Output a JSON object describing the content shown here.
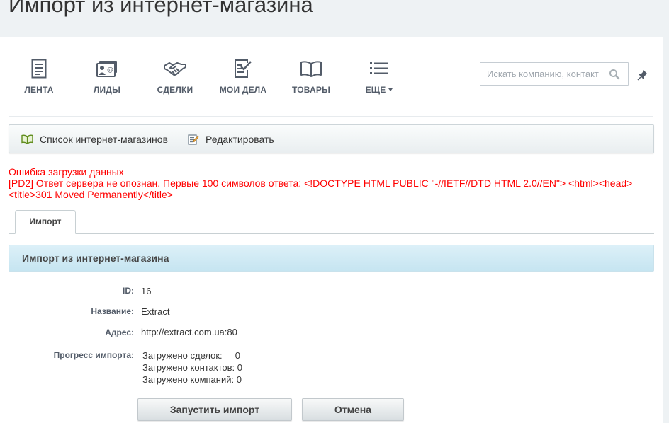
{
  "page_title": "Импорт из интернет-магазина",
  "crm_menu": {
    "items": [
      {
        "label": "ЛЕНТА",
        "icon": "feed-icon"
      },
      {
        "label": "ЛИДЫ",
        "icon": "leads-icon"
      },
      {
        "label": "СДЕЛКИ",
        "icon": "handshake-icon"
      },
      {
        "label": "МОИ ДЕЛА",
        "icon": "tasks-icon"
      },
      {
        "label": "ТОВАРЫ",
        "icon": "book-icon"
      },
      {
        "label": "ЕЩЕ",
        "icon": "list-icon"
      }
    ]
  },
  "search": {
    "placeholder": "Искать компанию, контакт"
  },
  "toolbar": {
    "list_label": "Список интернет-магазинов",
    "edit_label": "Редактировать"
  },
  "error": {
    "line1": "Ошибка загрузки данных",
    "line2": "[PD2] Ответ сервера не опознан. Первые 100 символов ответа: <!DOCTYPE HTML PUBLIC \"-//IETF//DTD HTML 2.0//EN\"> <html><head><title>301 Moved Permanently</title>"
  },
  "tab": {
    "label": "Импорт"
  },
  "section": {
    "title": "Импорт из интернет-магазина"
  },
  "form": {
    "id_label": "ID:",
    "id_value": "16",
    "name_label": "Название:",
    "name_value": "Extract",
    "address_label": "Адрес:",
    "address_value": "http://extract.com.ua:80",
    "progress_label": "Прогресс импорта:",
    "progress": [
      "Загружено сделок:     0",
      "Загружено контактов: 0",
      "Загружено компаний: 0"
    ]
  },
  "buttons": {
    "start": "Запустить импорт",
    "cancel": "Отмена"
  },
  "colors": {
    "error": "#ff0000",
    "section_header": "#c6e5f1",
    "icon": "#535c69"
  }
}
